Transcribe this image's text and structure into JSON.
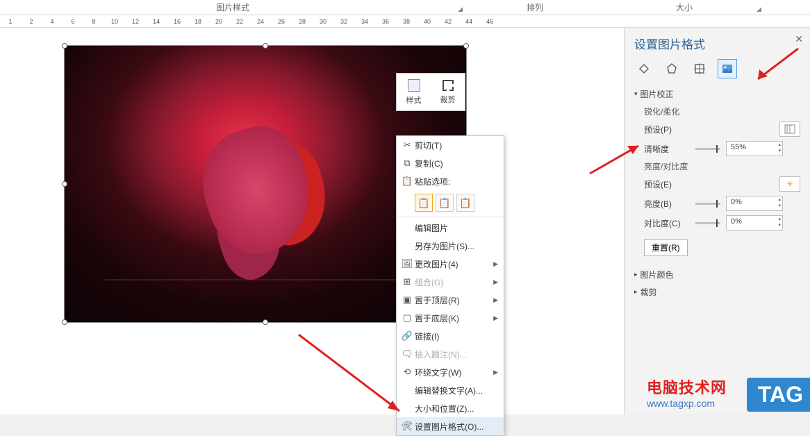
{
  "top_tabs": {
    "t1": "图片样式",
    "t2": "排列",
    "t3": "大小"
  },
  "ruler": [
    1,
    2,
    4,
    6,
    8,
    10,
    12,
    14,
    16,
    18,
    20,
    22,
    24,
    26,
    28,
    30,
    32,
    34,
    36,
    38,
    40,
    42,
    44,
    46
  ],
  "mini_toolbar": {
    "style": "样式",
    "crop": "裁剪"
  },
  "context_menu": {
    "cut": "剪切(T)",
    "copy": "复制(C)",
    "paste_opts": "粘贴选项:",
    "edit_pic": "编辑图片",
    "save_as_pic": "另存为图片(S)...",
    "change_pic": "更改图片(4)",
    "group": "组合(G)",
    "bring_front": "置于顶层(R)",
    "send_back": "置于底层(K)",
    "link": "链接(I)",
    "insert_caption": "插入题注(N)...",
    "wrap_text": "环绕文字(W)",
    "edit_alt": "编辑替换文字(A)...",
    "size_pos": "大小和位置(Z)...",
    "format_pic": "设置图片格式(O)..."
  },
  "side_panel": {
    "title": "设置图片格式",
    "section_correct": "图片校正",
    "sharpen": "锐化/柔化",
    "preset_p": "预设(P)",
    "clarity": "清晰度",
    "clarity_val": "55%",
    "bright_contrast": "亮度/对比度",
    "preset_e": "预设(E)",
    "brightness": "亮度(B)",
    "brightness_val": "0%",
    "contrast": "对比度(C)",
    "contrast_val": "0%",
    "reset": "重置(R)",
    "section_color": "图片颜色",
    "section_crop": "裁剪"
  },
  "watermark": {
    "line1": "电脑技术网",
    "line2": "www.tagxp.com",
    "tag": "TAG"
  }
}
